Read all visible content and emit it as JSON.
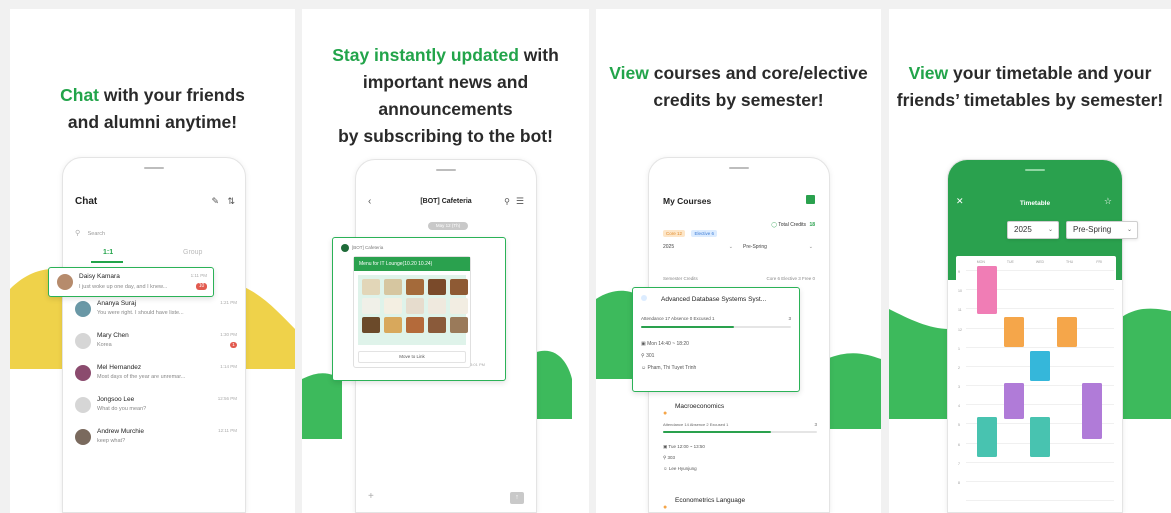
{
  "panel1": {
    "headline": {
      "highlight": "Chat",
      "line1_rest": " with your friends",
      "line2": "and alumni anytime!"
    },
    "screen": {
      "title": "Chat",
      "search_placeholder": "Search",
      "tabs": [
        "1:1",
        "Group"
      ],
      "rows": [
        {
          "name": "Daisy Kamara",
          "message": "I just woke up one day, and I knew...",
          "time": "1:11 PM",
          "badge": "10",
          "avatar_color": "#b68b6c"
        },
        {
          "name": "Ananya Suraj",
          "message": "You were right. I should have liste...",
          "time": "1:21 PM",
          "badge": "",
          "avatar_color": "#6a98a6"
        },
        {
          "name": "Mary Chen",
          "message": "Korea",
          "time": "1:30 PM",
          "badge": "1",
          "avatar_color": "#d6d6d6"
        },
        {
          "name": "Mel Hernandez",
          "message": "Most days of the year are unremar...",
          "time": "1:14 PM",
          "badge": "",
          "avatar_color": "#8b4b6e"
        },
        {
          "name": "Jongsoo Lee",
          "message": "What do you mean?",
          "time": "12:56 PM",
          "badge": "",
          "avatar_color": "#d6d6d6"
        },
        {
          "name": "Andrew Murchie",
          "message": "keep what?",
          "time": "12:11 PM",
          "badge": "",
          "avatar_color": "#7a6a5e"
        }
      ]
    }
  },
  "panel2": {
    "headline": {
      "highlight": "Stay instantly updated",
      "line1_rest": " with",
      "line2": "important news and announcements",
      "line3": "by subscribing to the bot!"
    },
    "screen": {
      "title": "[BOT] Cafeteria",
      "date": "May 12 (Th)",
      "bot_name": "[BOT] Cafeteria",
      "bubble_title": "Menu for IT Lounge(10.20 10.24)",
      "button_label": "Move to Link",
      "msg_time": "3:01 PM"
    }
  },
  "panel3": {
    "headline": {
      "highlight": "View",
      "line1_rest": " courses and core/elective",
      "line2": "credits by semester!"
    },
    "screen": {
      "title": "My Courses",
      "core_pill": "Core 12",
      "elective_pill": "Elective 6",
      "total_label": "Total Credits",
      "total_value": "18",
      "year": "2025",
      "semester": "Pre-Spring",
      "section_label": "Semester Credits",
      "section_stats": "Core 6  Elective 3  Free 0",
      "courses": [
        {
          "name": "Advanced Database Systems Syst...",
          "stats": "Attendance 17  Absence 0  Excused 1",
          "right": "3",
          "progress": 0.62,
          "time": "Mon 14:40 ~ 18:20",
          "room": "301",
          "prof": "Pham, Thi Tuyet Trinh"
        },
        {
          "name": "Macroeconomics",
          "stats": "Attendance 14  Absence 2  Excused 1",
          "right": "3",
          "progress": 0.7,
          "time": "Tue 12:00 ~ 13:50",
          "room": "303",
          "prof": "Lee Hyunjung"
        },
        {
          "name": "Econometrics Language",
          "stats": "",
          "right": "",
          "progress": 0,
          "time": "",
          "room": "",
          "prof": ""
        }
      ]
    }
  },
  "panel4": {
    "headline": {
      "highlight": "View",
      "line1_rest": " your timetable and your",
      "line2": "friends’ timetables by semester!"
    },
    "screen": {
      "title": "Timetable",
      "year": "2025",
      "semester": "Pre-Spring",
      "days": [
        "MON",
        "TUE",
        "WED",
        "THU",
        "FRI"
      ],
      "hours": [
        "9",
        "10",
        "11",
        "12",
        "1",
        "2",
        "3",
        "4",
        "5",
        "6",
        "7",
        "8"
      ]
    }
  },
  "colors": {
    "green": "#22a44a",
    "yellow": "#f0d04a",
    "pink": "#f07db5",
    "orange": "#f5a64a",
    "cyan": "#35b7da",
    "purple": "#b07bd8",
    "teal": "#48c3b0"
  }
}
